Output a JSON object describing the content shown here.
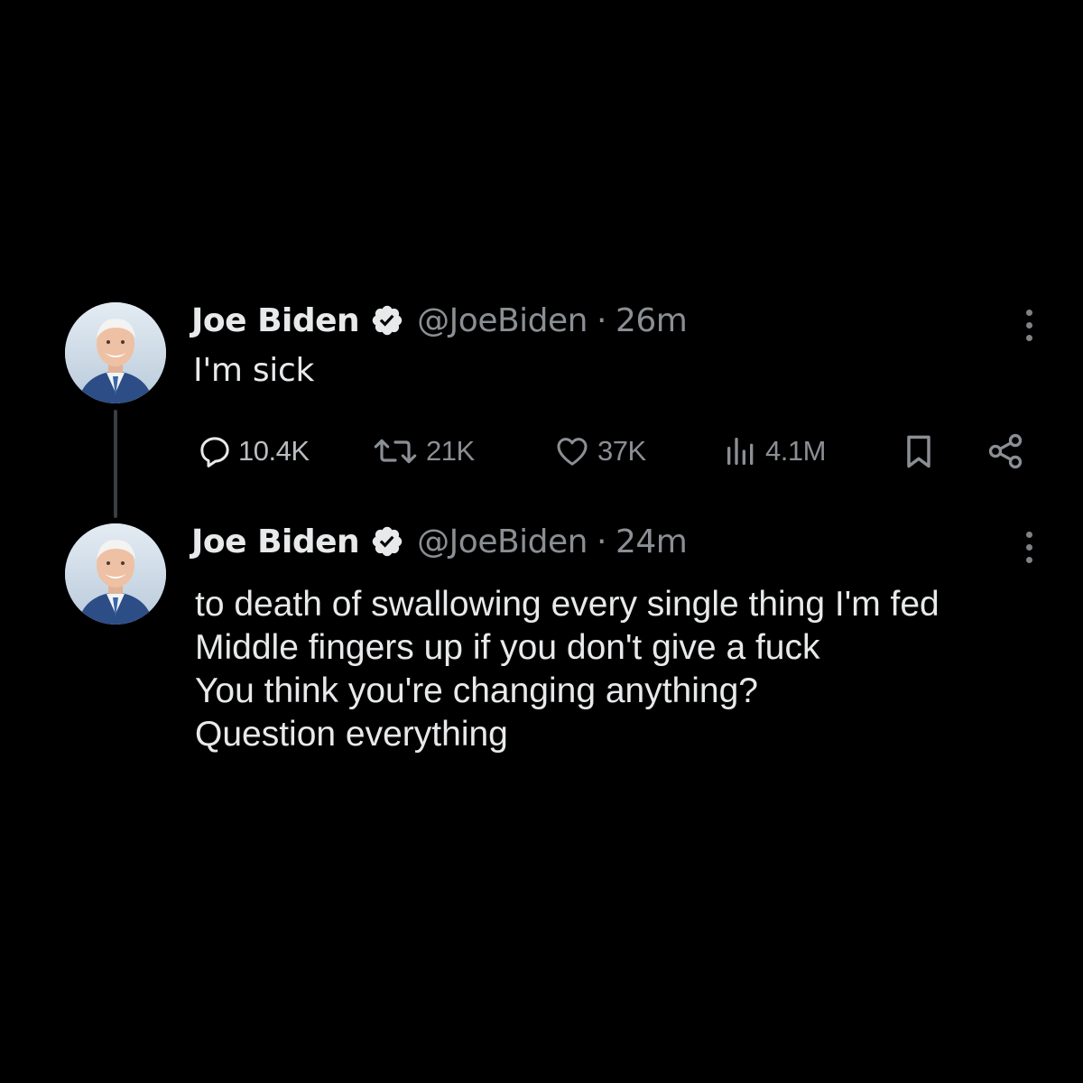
{
  "colors": {
    "background": "#000000",
    "text": "#e7e9ea",
    "muted": "#8b8f94",
    "badge": "#e7e9ea"
  },
  "tweets": [
    {
      "author_name": "Joe Biden",
      "handle": "@JoeBiden",
      "separator": "·",
      "time": "26m",
      "text": "I'm sick",
      "verified_icon": "verified-badge-icon",
      "actions": {
        "replies": "10.4K",
        "reposts": "21K",
        "likes": "37K",
        "views": "4.1M"
      }
    },
    {
      "author_name": "Joe Biden",
      "handle": "@JoeBiden",
      "separator": "·",
      "time": "24m",
      "verified_icon": "verified-badge-icon",
      "lines": [
        "to death of swallowing every single thing I'm fed",
        "Middle fingers up if you don't give a fuck",
        "You think you're changing anything?",
        "Question everything"
      ]
    }
  ],
  "icons": [
    "reply-icon",
    "repost-icon",
    "like-icon",
    "views-icon",
    "bookmark-icon",
    "share-icon",
    "more-options-icon"
  ]
}
